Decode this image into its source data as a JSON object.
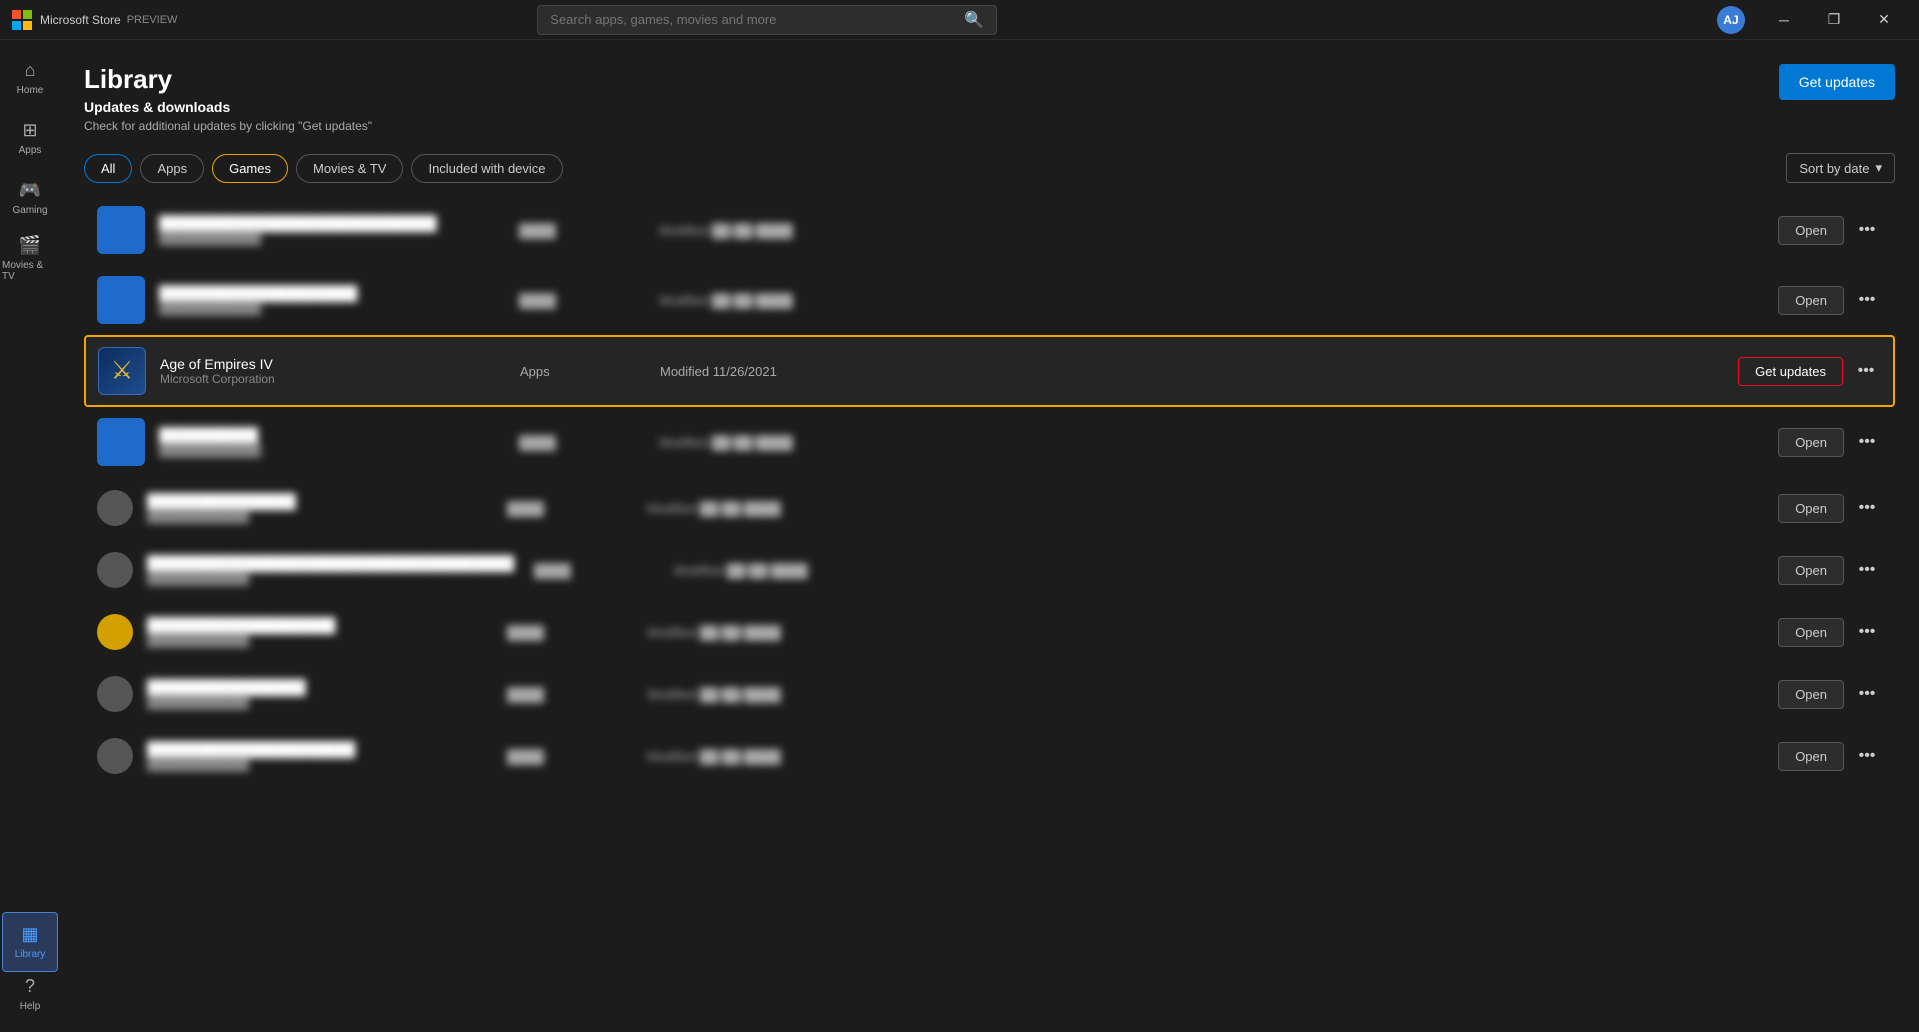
{
  "titlebar": {
    "app_name": "Microsoft Store",
    "preview_label": "PREVIEW",
    "search_placeholder": "Search apps, games, movies and more",
    "avatar_initials": "AJ",
    "min_btn": "─",
    "restore_btn": "❐",
    "close_btn": "✕"
  },
  "sidebar": {
    "items": [
      {
        "id": "home",
        "icon": "⌂",
        "label": "Home"
      },
      {
        "id": "apps",
        "icon": "⊞",
        "label": "Apps"
      },
      {
        "id": "gaming",
        "icon": "🎮",
        "label": "Gaming"
      },
      {
        "id": "movies",
        "icon": "🎬",
        "label": "Movies & TV"
      }
    ],
    "bottom_items": [
      {
        "id": "library",
        "icon": "▦",
        "label": "Library",
        "active": true
      },
      {
        "id": "help",
        "icon": "?",
        "label": "Help"
      }
    ]
  },
  "library": {
    "title": "Library",
    "updates_title": "Updates & downloads",
    "updates_subtitle": "Check for additional updates by clicking \"Get updates\"",
    "get_updates_label": "Get updates"
  },
  "filters": {
    "tabs": [
      {
        "id": "all",
        "label": "All",
        "active": true
      },
      {
        "id": "apps",
        "label": "Apps"
      },
      {
        "id": "games",
        "label": "Games",
        "outlined": true
      },
      {
        "id": "movies",
        "label": "Movies & TV"
      },
      {
        "id": "included",
        "label": "Included with device"
      }
    ],
    "sort_label": "Sort by date",
    "sort_icon": "▾"
  },
  "list_items": [
    {
      "id": "row1",
      "icon_type": "blue",
      "name": "████████████████████████████",
      "publisher": "████████████",
      "category": "████",
      "date": "Modified ██/██/████",
      "action": "Open",
      "blurred": true
    },
    {
      "id": "row2",
      "icon_type": "blue",
      "name": "████████████████████",
      "publisher": "████████████",
      "category": "████",
      "date": "Modified ██/██/████",
      "action": "Open",
      "blurred": true
    },
    {
      "id": "row3",
      "icon_type": "age_of_empires",
      "name": "Age of Empires IV",
      "publisher": "Microsoft Corporation",
      "category": "Apps",
      "date": "Modified 11/26/2021",
      "action": "Get updates",
      "highlighted": true,
      "blurred": false
    },
    {
      "id": "row4",
      "icon_type": "blue",
      "name": "██████████",
      "publisher": "████████████",
      "category": "████",
      "date": "Modified ██/██/████",
      "action": "Open",
      "blurred": true
    },
    {
      "id": "row5",
      "icon_type": "gray",
      "name": "███████████████",
      "publisher": "████████████",
      "category": "████",
      "date": "Modified ██/██/████",
      "action": "Open",
      "blurred": true
    },
    {
      "id": "row6",
      "icon_type": "gray",
      "name": "█████████████████████████████████████",
      "publisher": "████████████",
      "category": "████",
      "date": "Modified ██/██/████",
      "action": "Open",
      "blurred": true
    },
    {
      "id": "row7",
      "icon_type": "yellow",
      "name": "███████████████████",
      "publisher": "████████████",
      "category": "████",
      "date": "Modified ██/██/████",
      "action": "Open",
      "blurred": true
    },
    {
      "id": "row8",
      "icon_type": "gray",
      "name": "████████████████",
      "publisher": "████████████",
      "category": "████",
      "date": "Modified ██/██/████",
      "action": "Open",
      "blurred": true
    },
    {
      "id": "row9",
      "icon_type": "gray",
      "name": "█████████████████████",
      "publisher": "████████████",
      "category": "████",
      "date": "Modified ██/██/████",
      "action": "Open",
      "blurred": true
    }
  ]
}
